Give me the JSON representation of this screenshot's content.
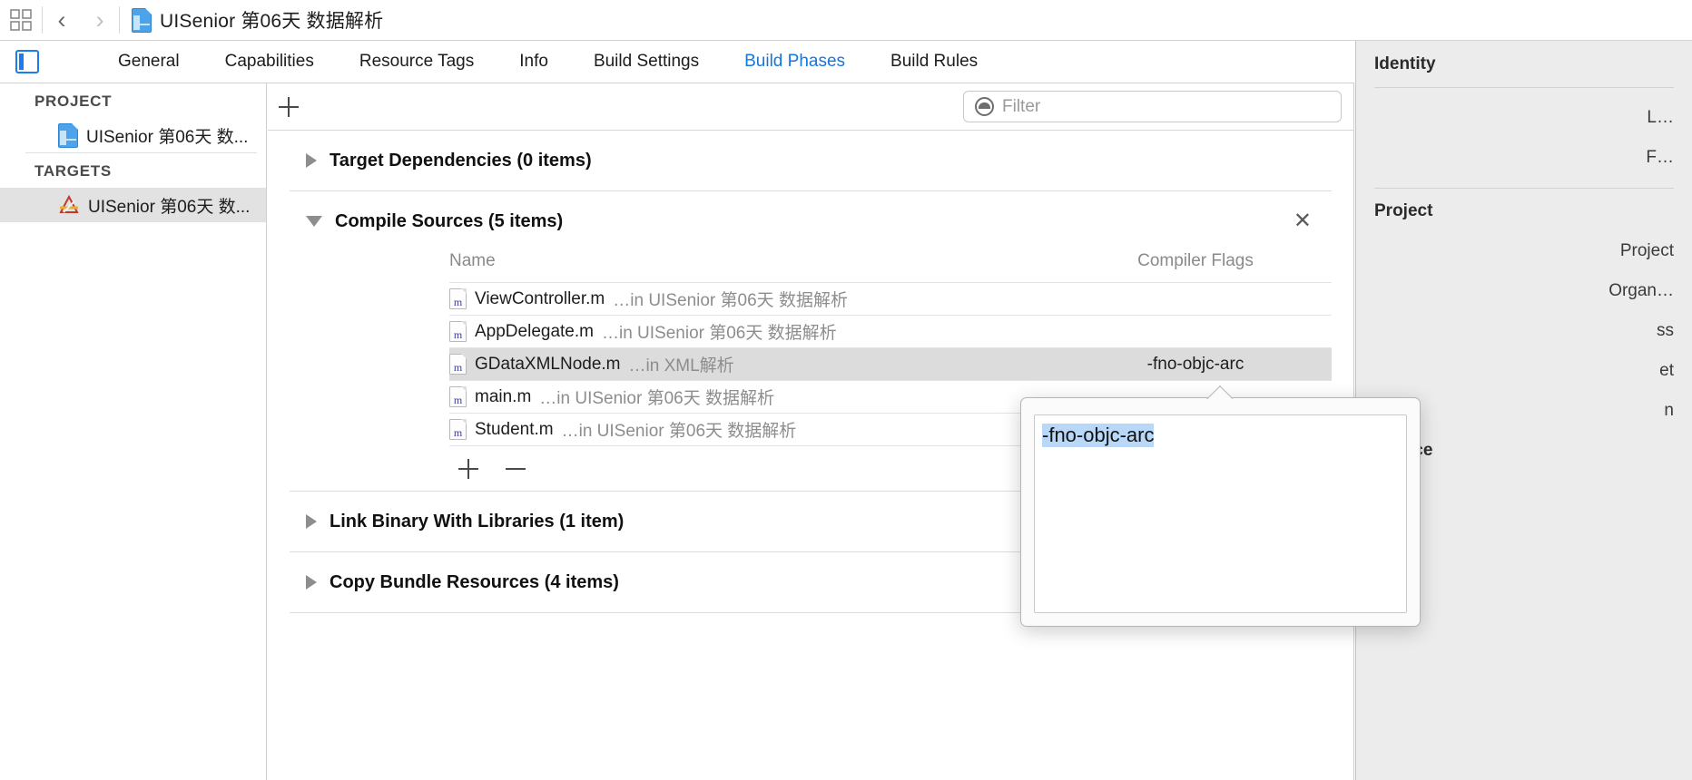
{
  "toolbar": {
    "grid_icon": "grid-icon",
    "back_label": "‹",
    "forward_label": "›",
    "breadcrumb_title": "UISenior 第06天 数据解析"
  },
  "tabbar": {
    "panel_toggle": "navigator-toggle",
    "tabs": [
      {
        "label": "General",
        "active": false
      },
      {
        "label": "Capabilities",
        "active": false
      },
      {
        "label": "Resource Tags",
        "active": false
      },
      {
        "label": "Info",
        "active": false
      },
      {
        "label": "Build Settings",
        "active": false
      },
      {
        "label": "Build Phases",
        "active": true
      },
      {
        "label": "Build Rules",
        "active": false
      }
    ]
  },
  "sidebar": {
    "project_header": "PROJECT",
    "project_item": "UISenior 第06天 数...",
    "targets_header": "TARGETS",
    "target_item": "UISenior 第06天 数..."
  },
  "phase_toolbar": {
    "add_label": "add-phase",
    "filter_placeholder": "Filter",
    "filter_value": ""
  },
  "phases": [
    {
      "title": "Target Dependencies (0 items)",
      "expanded": false,
      "closable": false
    },
    {
      "title": "Compile Sources (5 items)",
      "expanded": true,
      "closable": true,
      "columns": {
        "name": "Name",
        "flags": "Compiler Flags"
      },
      "rows": [
        {
          "icon": "m",
          "name": "ViewController.m",
          "location": "…in UISenior 第06天 数据解析",
          "flags": "",
          "selected": false
        },
        {
          "icon": "m",
          "name": "AppDelegate.m",
          "location": "…in UISenior 第06天 数据解析",
          "flags": "",
          "selected": false
        },
        {
          "icon": "m",
          "name": "GDataXMLNode.m",
          "location": "…in XML解析",
          "flags": "-fno-objc-arc",
          "selected": true
        },
        {
          "icon": "m",
          "name": "main.m",
          "location": "…in UISenior 第06天 数据解析",
          "flags": "",
          "selected": false
        },
        {
          "icon": "m",
          "name": "Student.m",
          "location": "…in UISenior 第06天 数据解析",
          "flags": "",
          "selected": false
        }
      ],
      "footer": {
        "add": "+",
        "remove": "−"
      }
    },
    {
      "title": "Link Binary With Libraries (1 item)",
      "expanded": false,
      "closable": false
    },
    {
      "title": "Copy Bundle Resources (4 items)",
      "expanded": false,
      "closable": false
    }
  ],
  "popover": {
    "value": "-fno-objc-arc"
  },
  "inspector": {
    "identity_title": "Identity",
    "label_location": "L…",
    "label_full_path": "F…",
    "project_document_title": "Project ",
    "project_name_label": "Project ",
    "organization_label": "Organ…",
    "class_prefix_label": "ss",
    "text_settings_label": "et",
    "indent_label": "n",
    "source_control_title": "Source "
  },
  "colors": {
    "accent": "#1576e0",
    "selection": "#dcdcdc",
    "popover_highlight": "#b9d8f7",
    "inspector_bg": "#ececec"
  }
}
